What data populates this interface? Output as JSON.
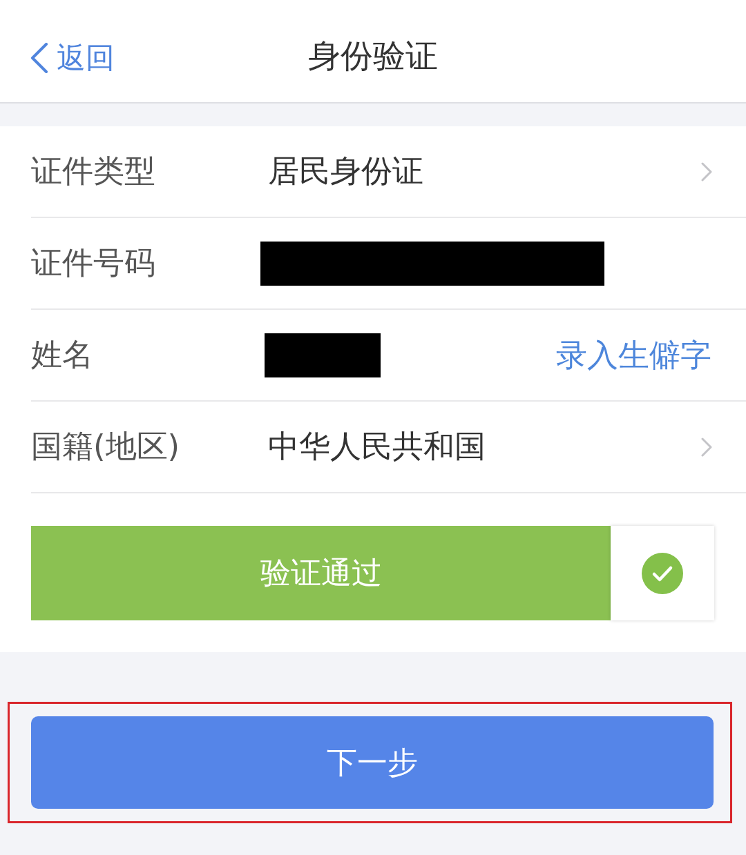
{
  "nav_bar": {
    "back_label": "返回",
    "title": "身份验证"
  },
  "form_rows": [
    {
      "kind": "select",
      "label": "证件类型",
      "value": "居民身份证"
    },
    {
      "kind": "masked",
      "label": "证件号码"
    },
    {
      "kind": "masked",
      "label": "姓名",
      "link": "录入生僻字"
    },
    {
      "kind": "select",
      "label": "国籍(地区)",
      "value": "中华人民共和国"
    }
  ],
  "verification": {
    "label": "验证通过",
    "verified": true
  },
  "next_button": {
    "label": "下一步",
    "highlighted": true
  }
}
